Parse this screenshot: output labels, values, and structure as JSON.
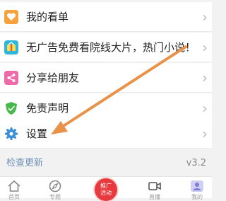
{
  "menu": {
    "items": [
      {
        "label": "我的看单",
        "icon": "heart-icon"
      },
      {
        "label": "无广告免费看院线大片，热门小说！",
        "icon": "gift-tv-icon"
      },
      {
        "label": "分享给朋友",
        "icon": "share-icon"
      },
      {
        "label": "免责声明",
        "icon": "shield-icon"
      },
      {
        "label": "设置",
        "icon": "gear-icon"
      }
    ]
  },
  "update": {
    "label": "检查更新",
    "version": "v3.2"
  },
  "tabbar": {
    "tabs": [
      {
        "label": "首页",
        "icon": "home-icon"
      },
      {
        "label": "专题",
        "icon": "compass-icon"
      },
      {
        "label": "直播",
        "icon": "video-camera-icon"
      },
      {
        "label": "我的",
        "icon": "profile-icon"
      }
    ],
    "promo": {
      "line1": "推广",
      "line2": "活动"
    }
  },
  "colors": {
    "annotation_arrow": "#e8924a",
    "promo": "#e8393e",
    "update_link": "#6f8fb5"
  }
}
